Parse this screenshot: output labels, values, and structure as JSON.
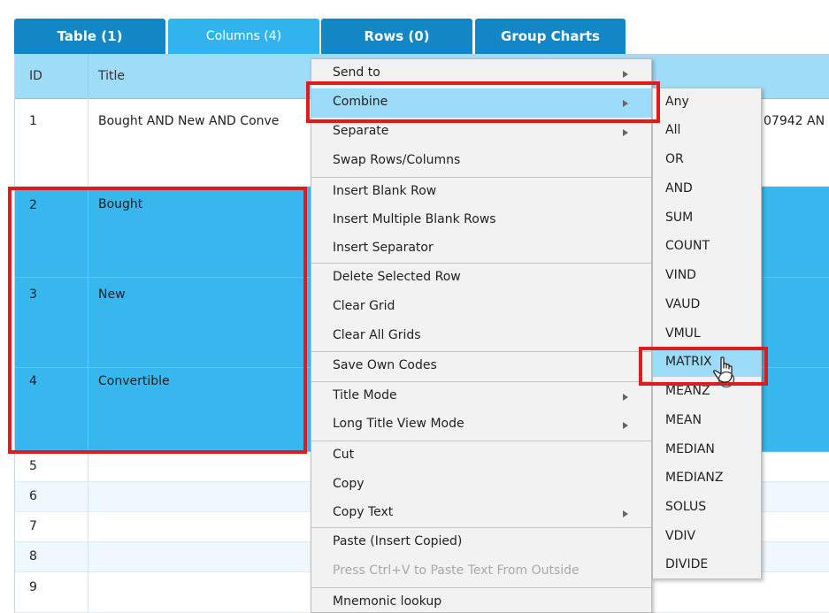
{
  "tabs": [
    {
      "label": "Table (1)"
    },
    {
      "label": "Columns (4)"
    },
    {
      "label": "Rows (0)"
    },
    {
      "label": "Group Charts"
    }
  ],
  "grid": {
    "headers": {
      "id": "ID",
      "title": "Title"
    },
    "rows": [
      {
        "id": "1",
        "title": "Bought AND New AND Conve",
        "right_fragment": "07942 AN"
      },
      {
        "id": "2",
        "title": "Bought"
      },
      {
        "id": "3",
        "title": "New"
      },
      {
        "id": "4",
        "title": "Convertible"
      },
      {
        "id": "5",
        "title": ""
      },
      {
        "id": "6",
        "title": ""
      },
      {
        "id": "7",
        "title": ""
      },
      {
        "id": "8",
        "title": ""
      },
      {
        "id": "9",
        "title": ""
      }
    ]
  },
  "context_menu": {
    "items": [
      {
        "label": "Send to"
      },
      {
        "label": "Combine"
      },
      {
        "label": "Separate"
      },
      {
        "label": "Swap Rows/Columns"
      },
      {
        "label": "Insert Blank Row"
      },
      {
        "label": "Insert Multiple Blank Rows"
      },
      {
        "label": "Insert Separator"
      },
      {
        "label": "Delete Selected Row"
      },
      {
        "label": "Clear Grid"
      },
      {
        "label": "Clear All Grids"
      },
      {
        "label": "Save Own Codes"
      },
      {
        "label": "Title Mode"
      },
      {
        "label": "Long Title View Mode"
      },
      {
        "label": "Cut"
      },
      {
        "label": "Copy"
      },
      {
        "label": "Copy Text"
      },
      {
        "label": "Paste (Insert Copied)"
      },
      {
        "label": "Press Ctrl+V to Paste Text From Outside"
      },
      {
        "label": "Mnemonic lookup"
      }
    ]
  },
  "combine_submenu": {
    "items": [
      "Any",
      "All",
      "OR",
      "AND",
      "SUM",
      "COUNT",
      "VIND",
      "VAUD",
      "VMUL",
      "MATRIX",
      "MEANZ",
      "MEAN",
      "MEDIAN",
      "MEDIANZ",
      "SOLUS",
      "VDIV",
      "DIVIDE"
    ]
  },
  "colors": {
    "tab_dark": "#1386c6",
    "tab_light": "#31b4ee",
    "header_bg": "#9edcf8",
    "selection": "#38b7ef",
    "menu_highlight": "#9cdcf8",
    "annotation_red": "#e01b1b"
  },
  "icons": {
    "submenu_arrow": "triangle-right-icon",
    "cursor": "hand-pointer-icon"
  }
}
